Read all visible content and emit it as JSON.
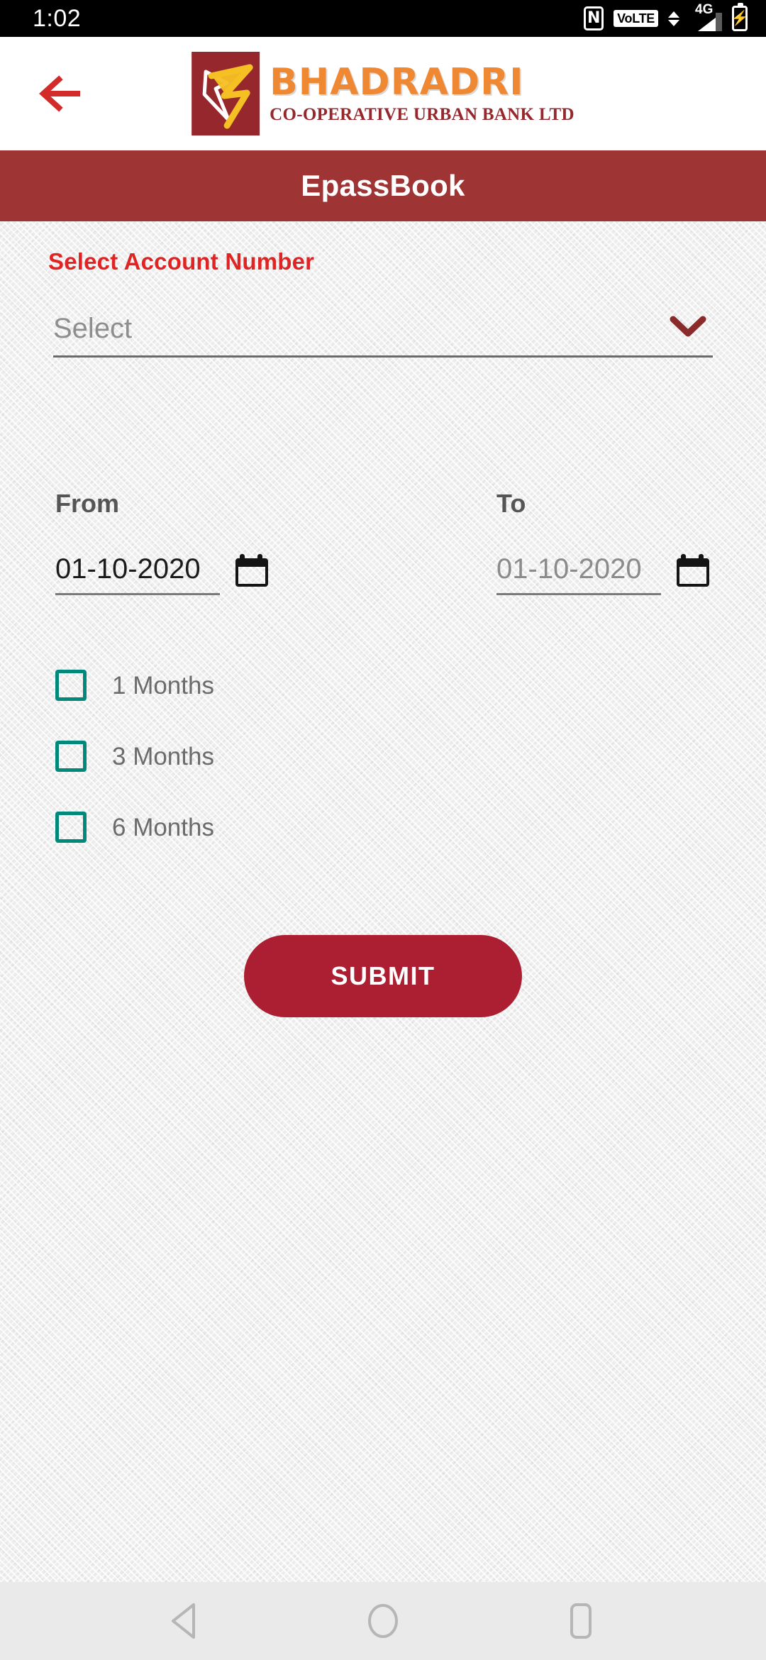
{
  "status_bar": {
    "time": "1:02",
    "icons": [
      {
        "name": "nfc-icon",
        "glyph": "N"
      },
      {
        "name": "volte-icon",
        "label": "VoLTE"
      },
      {
        "name": "data-transfer-icon",
        "label": ""
      },
      {
        "name": "signal-4g-icon",
        "label": "4G"
      },
      {
        "name": "battery-charging-icon",
        "glyph": "⚡"
      }
    ]
  },
  "app_bar": {
    "back_label": "",
    "logo": {
      "title": "BHADRADRI",
      "subtitle": "CO-OPERATIVE URBAN BANK LTD",
      "mark_bg": "#96272c",
      "title_color": "#ee8833",
      "subtitle_color": "#96272c"
    }
  },
  "title_bar": {
    "title": "EpassBook",
    "bg": "#9e3434"
  },
  "form": {
    "account": {
      "label": "Select Account Number",
      "label_color": "#e02424",
      "placeholder": "Select",
      "selected_value": "Select",
      "chevron_color": "#8a2a2a"
    },
    "from": {
      "label": "From",
      "value": "01-10-2020",
      "calendar_icon": "calendar-icon"
    },
    "to": {
      "label": "To",
      "value": "01-10-2020",
      "calendar_icon": "calendar-icon"
    },
    "duration_options": [
      {
        "label": "1 Months",
        "checked": false
      },
      {
        "label": "3 Months",
        "checked": false
      },
      {
        "label": "6 Months",
        "checked": false
      }
    ],
    "checkbox_color": "#00897b",
    "submit": {
      "label": "SUBMIT",
      "bg": "#ac1f33",
      "text_color": "#ffffff"
    }
  },
  "nav_bar": {
    "items": [
      {
        "name": "nav-back-icon",
        "label": "Back"
      },
      {
        "name": "nav-home-icon",
        "label": "Home"
      },
      {
        "name": "nav-recents-icon",
        "label": "Recents"
      }
    ]
  }
}
